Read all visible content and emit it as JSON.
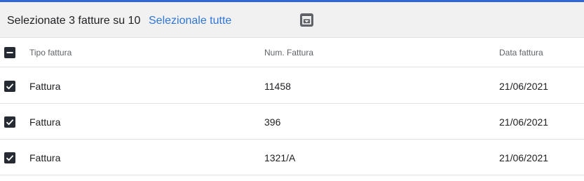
{
  "selection_bar": {
    "count_text": "Selezionate 3 fatture su 10",
    "select_all_label": "Selezionale tutte",
    "archive_icon": "archive-download-icon"
  },
  "table": {
    "columns": [
      "Tipo fattura",
      "Num. Fattura",
      "Data fattura"
    ],
    "header_checkbox_state": "indeterminate",
    "rows": [
      {
        "type": "Fattura",
        "number": "11458",
        "date": "21/06/2021",
        "checked": true
      },
      {
        "type": "Fattura",
        "number": "396",
        "date": "21/06/2021",
        "checked": true
      },
      {
        "type": "Fattura",
        "number": "1321/A",
        "date": "21/06/2021",
        "checked": true
      }
    ]
  },
  "colors": {
    "accent_bar": "#2f67d8",
    "link": "#2f76d8",
    "checkbox": "#262b33"
  }
}
